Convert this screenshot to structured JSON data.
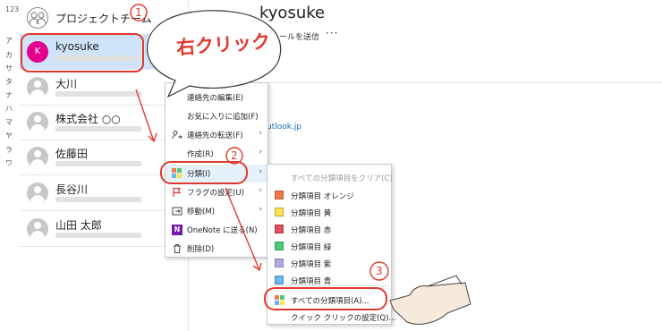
{
  "alpha_index": [
    "123",
    "ア",
    "カ",
    "サ",
    "タ",
    "ナ",
    "ハ",
    "マ",
    "ヤ",
    "ラ",
    "ワ"
  ],
  "contacts": [
    {
      "name": "プロジェクトチーム"
    },
    {
      "name": "kyosuke",
      "initial": "K"
    },
    {
      "name": "大川"
    },
    {
      "name": "株式会社 ○○"
    },
    {
      "name": "佐藤田"
    },
    {
      "name": "長谷川"
    },
    {
      "name": "山田 太郎"
    }
  ],
  "detail": {
    "name": "kyosuke",
    "send_mail": "ールを送信",
    "more": "···",
    "email_fragment": "utlook.jp"
  },
  "context_menu": {
    "items": [
      {
        "label": "連絡先の編集(E)",
        "icon": ""
      },
      {
        "label": "お気に入りに追加(F)",
        "icon": ""
      },
      {
        "label": "連絡先の転送(F)",
        "icon": "forward-contact-icon",
        "arrow": "›"
      },
      {
        "label": "作成(R)",
        "icon": "",
        "arrow": "›"
      },
      {
        "label": "分類(I)",
        "icon": "categorize-icon",
        "arrow": "›"
      },
      {
        "label": "フラグの設定(U)",
        "icon": "flag-icon",
        "arrow": "›"
      },
      {
        "label": "移動(M)",
        "icon": "move-icon",
        "arrow": "›"
      },
      {
        "label": "OneNote に送る(N)",
        "icon": "onenote-icon"
      },
      {
        "label": "削除(D)",
        "icon": "delete-icon"
      }
    ]
  },
  "category_submenu": {
    "clear": "すべての分類項目をクリア(C)",
    "categories": [
      {
        "label": "分類項目 オレンジ",
        "color": "#f2784b"
      },
      {
        "label": "分類項目 黄",
        "color": "#ffe14d"
      },
      {
        "label": "分類項目 赤",
        "color": "#e0525f"
      },
      {
        "label": "分類項目 緑",
        "color": "#4ccc7a"
      },
      {
        "label": "分類項目 紫",
        "color": "#b8a7e8"
      },
      {
        "label": "分類項目 青",
        "color": "#6cb6ee"
      }
    ],
    "all_categories": "すべての分類項目(A)...",
    "quick_click": "クイック クリックの設定(Q)..."
  },
  "annotations": {
    "bubble": "右クリック",
    "step1": "1",
    "step2": "2",
    "step3": "3",
    "accent_color": "#e03a2e"
  }
}
